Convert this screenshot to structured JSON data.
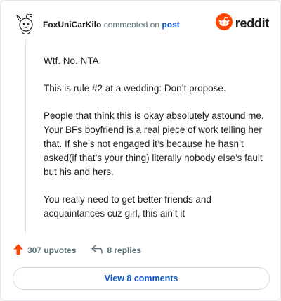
{
  "header": {
    "username": "FoxUniCarKilo",
    "action_text": "commented on",
    "target_link": "post",
    "brand_wordmark": "reddit",
    "avatar_icon": "snoo-avatar-icon",
    "brand_icon": "reddit-logo-icon",
    "brand_color": "#ff4500"
  },
  "comment": {
    "paragraphs": [
      "Wtf. No. NTA.",
      "This is rule #2 at a wedding: Don’t propose.",
      "People that think this is okay absolutely astound me. Your BFs boyfriend is a real piece of work telling her that. If she’s not engaged it’s because he hasn’t asked(if that’s your thing) literally nobody else’s fault but his and hers.",
      "You really need to get better friends and acquaintances cuz girl, this ain’t it"
    ]
  },
  "actions": {
    "upvotes_label": "307 upvotes",
    "replies_label": "8 replies",
    "upvote_icon": "upvote-arrow-icon",
    "reply_icon": "reply-arrow-icon",
    "upvote_color": "#ff4500"
  },
  "footer": {
    "view_comments_label": "View 8 comments"
  }
}
